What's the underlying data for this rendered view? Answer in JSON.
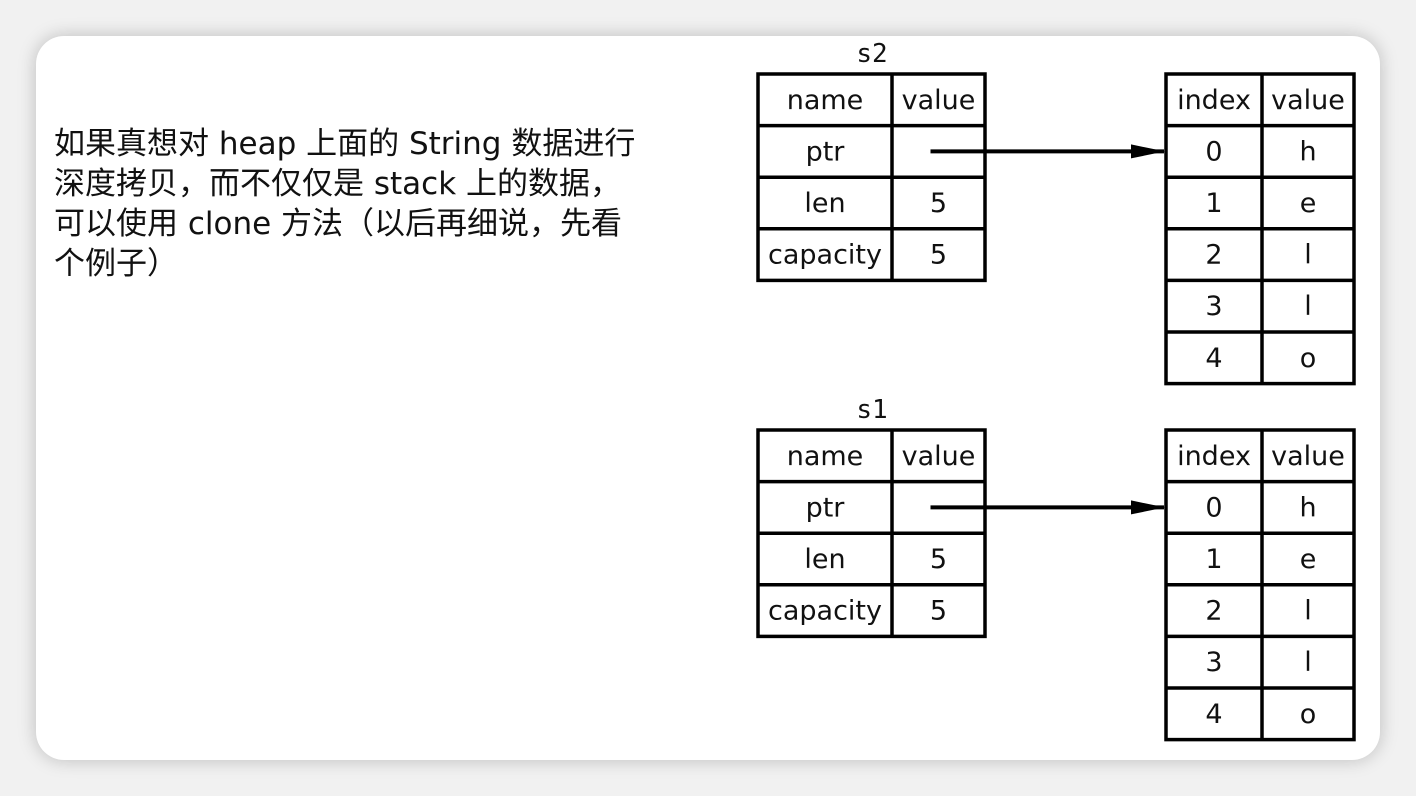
{
  "description_lines": [
    "如果真想对 heap 上面的 String 数据进行",
    "深度拷贝，而不仅仅是 stack 上的数据，",
    "可以使用 clone 方法（以后再细说，先看",
    "个例子）"
  ],
  "diagrams": [
    {
      "label": "s2",
      "stack": {
        "headers": [
          "name",
          "value"
        ],
        "rows": [
          [
            "ptr",
            ""
          ],
          [
            "len",
            "5"
          ],
          [
            "capacity",
            "5"
          ]
        ]
      },
      "heap": {
        "headers": [
          "index",
          "value"
        ],
        "rows": [
          [
            "0",
            "h"
          ],
          [
            "1",
            "e"
          ],
          [
            "2",
            "l"
          ],
          [
            "3",
            "l"
          ],
          [
            "4",
            "o"
          ]
        ]
      }
    },
    {
      "label": "s1",
      "stack": {
        "headers": [
          "name",
          "value"
        ],
        "rows": [
          [
            "ptr",
            ""
          ],
          [
            "len",
            "5"
          ],
          [
            "capacity",
            "5"
          ]
        ]
      },
      "heap": {
        "headers": [
          "index",
          "value"
        ],
        "rows": [
          [
            "0",
            "h"
          ],
          [
            "1",
            "e"
          ],
          [
            "2",
            "l"
          ],
          [
            "3",
            "l"
          ],
          [
            "4",
            "o"
          ]
        ]
      }
    }
  ]
}
